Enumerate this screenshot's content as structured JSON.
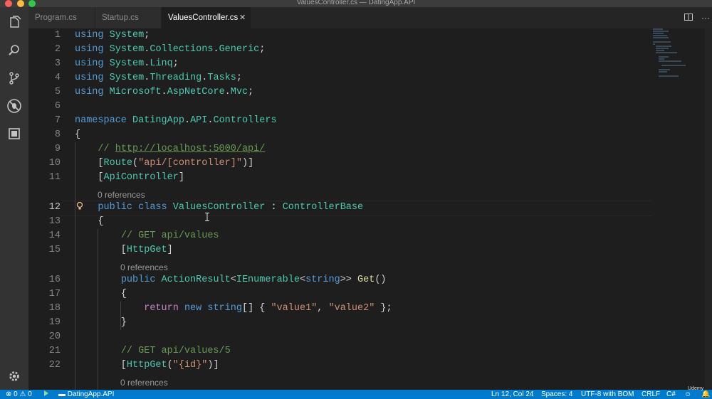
{
  "window": {
    "title": "ValuesController.cs — DatingApp.API"
  },
  "activity": {
    "icons": [
      "files-icon",
      "search-icon",
      "source-control-icon",
      "debug-icon",
      "extensions-icon",
      "gear-icon"
    ]
  },
  "tabs": [
    {
      "label": "Program.cs",
      "active": false
    },
    {
      "label": "Startup.cs",
      "active": false
    },
    {
      "label": "ValuesController.cs",
      "active": true
    }
  ],
  "tab_close_glyph": "✕",
  "editor": {
    "codelens_text": "0 references",
    "lines": [
      {
        "n": "1",
        "tokens": [
          [
            "kw",
            "using"
          ],
          [
            "pl",
            " "
          ],
          [
            "ty",
            "System"
          ],
          [
            "pl",
            ";"
          ]
        ]
      },
      {
        "n": "2",
        "tokens": [
          [
            "kw",
            "using"
          ],
          [
            "pl",
            " "
          ],
          [
            "ty",
            "System"
          ],
          [
            "pl",
            "."
          ],
          [
            "ty",
            "Collections"
          ],
          [
            "pl",
            "."
          ],
          [
            "ty",
            "Generic"
          ],
          [
            "pl",
            ";"
          ]
        ]
      },
      {
        "n": "3",
        "tokens": [
          [
            "kw",
            "using"
          ],
          [
            "pl",
            " "
          ],
          [
            "ty",
            "System"
          ],
          [
            "pl",
            "."
          ],
          [
            "ty",
            "Linq"
          ],
          [
            "pl",
            ";"
          ]
        ]
      },
      {
        "n": "4",
        "tokens": [
          [
            "kw",
            "using"
          ],
          [
            "pl",
            " "
          ],
          [
            "ty",
            "System"
          ],
          [
            "pl",
            "."
          ],
          [
            "ty",
            "Threading"
          ],
          [
            "pl",
            "."
          ],
          [
            "ty",
            "Tasks"
          ],
          [
            "pl",
            ";"
          ]
        ]
      },
      {
        "n": "5",
        "tokens": [
          [
            "kw",
            "using"
          ],
          [
            "pl",
            " "
          ],
          [
            "ty",
            "Microsoft"
          ],
          [
            "pl",
            "."
          ],
          [
            "ty",
            "AspNetCore"
          ],
          [
            "pl",
            "."
          ],
          [
            "ty",
            "Mvc"
          ],
          [
            "pl",
            ";"
          ]
        ]
      },
      {
        "n": "6",
        "tokens": []
      },
      {
        "n": "7",
        "tokens": [
          [
            "kw",
            "namespace"
          ],
          [
            "pl",
            " "
          ],
          [
            "ty",
            "DatingApp"
          ],
          [
            "pl",
            "."
          ],
          [
            "ty",
            "API"
          ],
          [
            "pl",
            "."
          ],
          [
            "ty",
            "Controllers"
          ]
        ]
      },
      {
        "n": "8",
        "tokens": [
          [
            "pl",
            "{"
          ]
        ]
      },
      {
        "n": "9",
        "tokens": [
          [
            "pl",
            "    "
          ],
          [
            "cm",
            "// "
          ],
          [
            "link",
            "http://localhost:5000/api/"
          ]
        ]
      },
      {
        "n": "10",
        "tokens": [
          [
            "pl",
            "    ["
          ],
          [
            "ty",
            "Route"
          ],
          [
            "pl",
            "("
          ],
          [
            "str",
            "\"api/[controller]\""
          ],
          [
            "pl",
            ")]"
          ]
        ]
      },
      {
        "n": "11",
        "tokens": [
          [
            "pl",
            "    ["
          ],
          [
            "ty",
            "ApiController"
          ],
          [
            "pl",
            "]"
          ]
        ]
      },
      {
        "n": "12",
        "tokens": [
          [
            "pl",
            "    "
          ],
          [
            "kw",
            "public"
          ],
          [
            "pl",
            " "
          ],
          [
            "kw",
            "class"
          ],
          [
            "pl",
            " "
          ],
          [
            "ty",
            "ValuesController"
          ],
          [
            "pl",
            " : "
          ],
          [
            "ty",
            "ControllerBase"
          ]
        ]
      },
      {
        "n": "13",
        "tokens": [
          [
            "pl",
            "    {"
          ]
        ]
      },
      {
        "n": "14",
        "tokens": [
          [
            "pl",
            "        "
          ],
          [
            "cm",
            "// GET api/values"
          ]
        ]
      },
      {
        "n": "15",
        "tokens": [
          [
            "pl",
            "        ["
          ],
          [
            "ty",
            "HttpGet"
          ],
          [
            "pl",
            "]"
          ]
        ]
      },
      {
        "n": "16",
        "tokens": [
          [
            "pl",
            "        "
          ],
          [
            "kw",
            "public"
          ],
          [
            "pl",
            " "
          ],
          [
            "ty",
            "ActionResult"
          ],
          [
            "pl",
            "<"
          ],
          [
            "ty",
            "IEnumerable"
          ],
          [
            "pl",
            "<"
          ],
          [
            "kw",
            "string"
          ],
          [
            "pl",
            ">> "
          ],
          [
            "fn",
            "Get"
          ],
          [
            "pl",
            "()"
          ]
        ]
      },
      {
        "n": "17",
        "tokens": [
          [
            "pl",
            "        {"
          ]
        ]
      },
      {
        "n": "18",
        "tokens": [
          [
            "pl",
            "            "
          ],
          [
            "ctl",
            "return"
          ],
          [
            "pl",
            " "
          ],
          [
            "kw",
            "new"
          ],
          [
            "pl",
            " "
          ],
          [
            "kw",
            "string"
          ],
          [
            "pl",
            "[] { "
          ],
          [
            "str",
            "\"value1\""
          ],
          [
            "pl",
            ", "
          ],
          [
            "str",
            "\"value2\""
          ],
          [
            "pl",
            " };"
          ]
        ]
      },
      {
        "n": "19",
        "tokens": [
          [
            "pl",
            "        }"
          ]
        ]
      },
      {
        "n": "20",
        "tokens": []
      },
      {
        "n": "21",
        "tokens": [
          [
            "pl",
            "        "
          ],
          [
            "cm",
            "// GET api/values/5"
          ]
        ]
      },
      {
        "n": "22",
        "tokens": [
          [
            "pl",
            "        ["
          ],
          [
            "ty",
            "HttpGet"
          ],
          [
            "pl",
            "("
          ],
          [
            "str",
            "\"{id}\""
          ],
          [
            "pl",
            ")]"
          ]
        ]
      }
    ]
  },
  "statusbar": {
    "errors": "0",
    "warnings": "0",
    "folder": "DatingApp.API",
    "position": "Ln 12, Col 24",
    "spaces": "Spaces: 4",
    "encoding": "UTF-8 with BOM",
    "eol": "CRLF",
    "language": "C#",
    "watermark": "Udemy"
  },
  "colors": {
    "statusbar": "#007acc",
    "editor_bg": "#1e1e1e",
    "keyword": "#569cd6",
    "type": "#4ec9b0",
    "string": "#ce9178",
    "comment": "#6a9955"
  }
}
